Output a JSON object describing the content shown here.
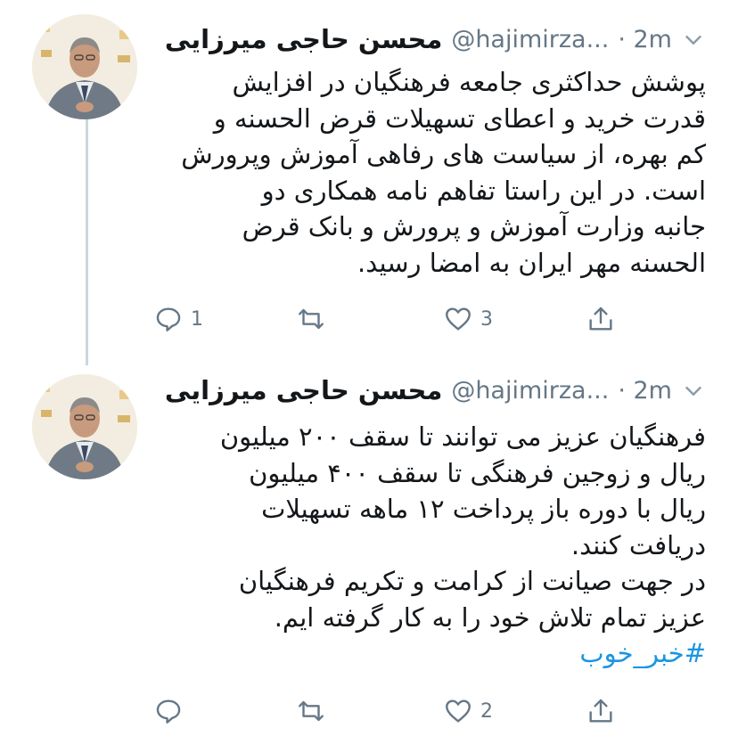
{
  "colors": {
    "text": "#14171a",
    "muted": "#657786",
    "link": "#1b95e0",
    "thread_line": "#ccd6dd"
  },
  "tweets": [
    {
      "name": "محسن حاجی میرزایی",
      "handle": "@hajimirza...",
      "time": "· 2m",
      "lines": [
        "پوشش حداکثری جامعه فرهنگیان در افزایش",
        "قدرت خرید و اعطای تسهیلات قرض الحسنه و",
        "کم بهره، از سیاست های رفاهی آموزش وپرورش",
        "است. در این راستا تفاهم نامه همکاری دو",
        "جانبه وزارت آموزش و پرورش و بانک قرض",
        "الحسنه مهر ایران به امضا رسید."
      ],
      "hashtag": "",
      "reply_count": "1",
      "retweet_count": "",
      "like_count": "3"
    },
    {
      "name": "محسن حاجی میرزایی",
      "handle": "@hajimirza...",
      "time": "· 2m",
      "lines": [
        "فرهنگیان عزیز می توانند تا سقف ۲۰۰ میلیون",
        "ریال و زوجین فرهنگی تا سقف ۴۰۰ میلیون",
        "ریال با دوره باز پرداخت ۱۲ ماهه تسهیلات",
        "دریافت کنند.",
        "در جهت صیانت از کرامت و تکریم فرهنگیان",
        "عزیز تمام تلاش خود را به کار گرفته ایم."
      ],
      "hashtag": "#خبر_خوب",
      "reply_count": "",
      "retweet_count": "",
      "like_count": "2"
    }
  ],
  "icons": {
    "reply": "reply-icon",
    "retweet": "retweet-icon",
    "like": "heart-icon",
    "share": "share-icon",
    "menu": "chevron-down-icon"
  }
}
